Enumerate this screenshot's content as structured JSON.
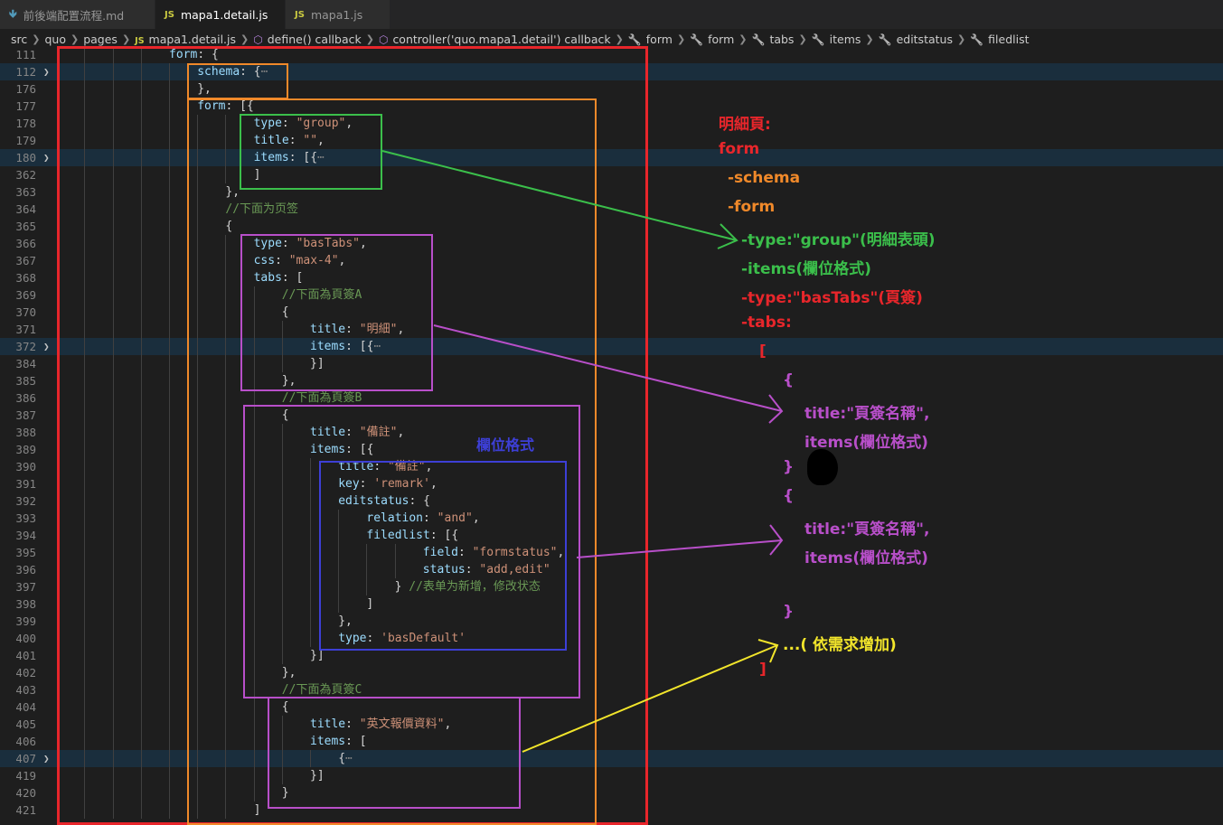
{
  "tabs": [
    {
      "icon": "markdown-icon",
      "label": "前後端配置流程.md",
      "active": false,
      "dirty": false
    },
    {
      "icon": "JS",
      "label": "mapa1.detail.js",
      "active": true,
      "dirty": true
    },
    {
      "icon": "JS",
      "label": "mapa1.js",
      "active": false,
      "dirty": false
    }
  ],
  "breadcrumb": [
    {
      "icon": "",
      "label": "src"
    },
    {
      "icon": "",
      "label": "quo"
    },
    {
      "icon": "",
      "label": "pages"
    },
    {
      "icon": "js",
      "label": "mapa1.detail.js"
    },
    {
      "icon": "cube",
      "label": "define() callback"
    },
    {
      "icon": "cube",
      "label": "controller('quo.mapa1.detail') callback"
    },
    {
      "icon": "wrench",
      "label": "form"
    },
    {
      "icon": "wrench",
      "label": "form"
    },
    {
      "icon": "wrench",
      "label": "tabs"
    },
    {
      "icon": "wrench",
      "label": "items"
    },
    {
      "icon": "wrench",
      "label": "editstatus"
    },
    {
      "icon": "wrench",
      "label": "filedlist"
    }
  ],
  "code_lines": [
    {
      "n": "111",
      "indent": 15,
      "fold": false,
      "hl": false,
      "tokens": [
        [
          "k",
          "form"
        ],
        [
          "p",
          ": {"
        ]
      ]
    },
    {
      "n": "112",
      "indent": 19,
      "fold": true,
      "hl": true,
      "tokens": [
        [
          "k",
          "schema"
        ],
        [
          "p",
          ": {"
        ],
        [
          "e",
          "⋯"
        ]
      ]
    },
    {
      "n": "176",
      "indent": 19,
      "fold": false,
      "hl": false,
      "tokens": [
        [
          "p",
          "},"
        ]
      ]
    },
    {
      "n": "177",
      "indent": 19,
      "fold": false,
      "hl": false,
      "tokens": [
        [
          "k",
          "form"
        ],
        [
          "p",
          ": [{"
        ]
      ]
    },
    {
      "n": "178",
      "indent": 27,
      "fold": false,
      "hl": false,
      "tokens": [
        [
          "k",
          "type"
        ],
        [
          "p",
          ": "
        ],
        [
          "s",
          "\"group\""
        ],
        [
          "p",
          ","
        ]
      ]
    },
    {
      "n": "179",
      "indent": 27,
      "fold": false,
      "hl": false,
      "tokens": [
        [
          "k",
          "title"
        ],
        [
          "p",
          ": "
        ],
        [
          "s",
          "\"\""
        ],
        [
          "p",
          ","
        ]
      ]
    },
    {
      "n": "180",
      "indent": 27,
      "fold": true,
      "hl": true,
      "tokens": [
        [
          "k",
          "items"
        ],
        [
          "p",
          ": [{"
        ],
        [
          "e",
          "⋯"
        ]
      ]
    },
    {
      "n": "362",
      "indent": 27,
      "fold": false,
      "hl": false,
      "tokens": [
        [
          "p",
          "]"
        ]
      ]
    },
    {
      "n": "363",
      "indent": 23,
      "fold": false,
      "hl": false,
      "tokens": [
        [
          "p",
          "},"
        ]
      ]
    },
    {
      "n": "364",
      "indent": 23,
      "fold": false,
      "hl": false,
      "tokens": [
        [
          "c",
          "//下面为页签"
        ]
      ]
    },
    {
      "n": "365",
      "indent": 23,
      "fold": false,
      "hl": false,
      "tokens": [
        [
          "p",
          "{"
        ]
      ]
    },
    {
      "n": "366",
      "indent": 27,
      "fold": false,
      "hl": false,
      "tokens": [
        [
          "k",
          "type"
        ],
        [
          "p",
          ": "
        ],
        [
          "s",
          "\"basTabs\""
        ],
        [
          "p",
          ","
        ]
      ]
    },
    {
      "n": "367",
      "indent": 27,
      "fold": false,
      "hl": false,
      "tokens": [
        [
          "k",
          "css"
        ],
        [
          "p",
          ": "
        ],
        [
          "s",
          "\"max-4\""
        ],
        [
          "p",
          ","
        ]
      ]
    },
    {
      "n": "368",
      "indent": 27,
      "fold": false,
      "hl": false,
      "tokens": [
        [
          "k",
          "tabs"
        ],
        [
          "p",
          ": ["
        ]
      ]
    },
    {
      "n": "369",
      "indent": 31,
      "fold": false,
      "hl": false,
      "tokens": [
        [
          "c",
          "//下面為頁簽A"
        ]
      ]
    },
    {
      "n": "370",
      "indent": 31,
      "fold": false,
      "hl": false,
      "tokens": [
        [
          "p",
          "{"
        ]
      ]
    },
    {
      "n": "371",
      "indent": 35,
      "fold": false,
      "hl": false,
      "tokens": [
        [
          "k",
          "title"
        ],
        [
          "p",
          ": "
        ],
        [
          "s",
          "\"明細\""
        ],
        [
          "p",
          ","
        ]
      ]
    },
    {
      "n": "372",
      "indent": 35,
      "fold": true,
      "hl": true,
      "tokens": [
        [
          "k",
          "items"
        ],
        [
          "p",
          ": [{"
        ],
        [
          "e",
          "⋯"
        ]
      ]
    },
    {
      "n": "384",
      "indent": 35,
      "fold": false,
      "hl": false,
      "tokens": [
        [
          "p",
          "}]"
        ]
      ]
    },
    {
      "n": "385",
      "indent": 31,
      "fold": false,
      "hl": false,
      "tokens": [
        [
          "p",
          "},"
        ]
      ]
    },
    {
      "n": "386",
      "indent": 31,
      "fold": false,
      "hl": false,
      "tokens": [
        [
          "c",
          "//下面為頁簽B"
        ]
      ]
    },
    {
      "n": "387",
      "indent": 31,
      "fold": false,
      "hl": false,
      "tokens": [
        [
          "p",
          "{"
        ]
      ]
    },
    {
      "n": "388",
      "indent": 35,
      "fold": false,
      "hl": false,
      "tokens": [
        [
          "k",
          "title"
        ],
        [
          "p",
          ": "
        ],
        [
          "s",
          "\"備註\""
        ],
        [
          "p",
          ","
        ]
      ]
    },
    {
      "n": "389",
      "indent": 35,
      "fold": false,
      "hl": false,
      "tokens": [
        [
          "k",
          "items"
        ],
        [
          "p",
          ": [{"
        ]
      ]
    },
    {
      "n": "390",
      "indent": 39,
      "fold": false,
      "hl": false,
      "tokens": [
        [
          "k",
          "title"
        ],
        [
          "p",
          ": "
        ],
        [
          "s",
          "\"備註\""
        ],
        [
          "p",
          ","
        ]
      ]
    },
    {
      "n": "391",
      "indent": 39,
      "fold": false,
      "hl": false,
      "tokens": [
        [
          "k",
          "key"
        ],
        [
          "p",
          ": "
        ],
        [
          "s",
          "'remark'"
        ],
        [
          "p",
          ","
        ]
      ]
    },
    {
      "n": "392",
      "indent": 39,
      "fold": false,
      "hl": false,
      "tokens": [
        [
          "k",
          "editstatus"
        ],
        [
          "p",
          ": {"
        ]
      ]
    },
    {
      "n": "393",
      "indent": 43,
      "fold": false,
      "hl": false,
      "tokens": [
        [
          "k",
          "relation"
        ],
        [
          "p",
          ": "
        ],
        [
          "s",
          "\"and\""
        ],
        [
          "p",
          ","
        ]
      ]
    },
    {
      "n": "394",
      "indent": 43,
      "fold": false,
      "hl": false,
      "tokens": [
        [
          "k",
          "filedlist"
        ],
        [
          "p",
          ": [{"
        ]
      ]
    },
    {
      "n": "395",
      "indent": 51,
      "fold": false,
      "hl": false,
      "tokens": [
        [
          "k",
          "field"
        ],
        [
          "p",
          ": "
        ],
        [
          "s",
          "\"formstatus\""
        ],
        [
          "p",
          ","
        ]
      ]
    },
    {
      "n": "396",
      "indent": 51,
      "fold": false,
      "hl": false,
      "tokens": [
        [
          "k",
          "status"
        ],
        [
          "p",
          ": "
        ],
        [
          "s",
          "\"add,edit\""
        ]
      ]
    },
    {
      "n": "397",
      "indent": 47,
      "fold": false,
      "hl": false,
      "tokens": [
        [
          "p",
          "} "
        ],
        [
          "c",
          "//表单为新增，修改状态"
        ]
      ]
    },
    {
      "n": "398",
      "indent": 43,
      "fold": false,
      "hl": false,
      "tokens": [
        [
          "p",
          "]"
        ]
      ]
    },
    {
      "n": "399",
      "indent": 39,
      "fold": false,
      "hl": false,
      "tokens": [
        [
          "p",
          "},"
        ]
      ]
    },
    {
      "n": "400",
      "indent": 39,
      "fold": false,
      "hl": false,
      "tokens": [
        [
          "k",
          "type"
        ],
        [
          "p",
          ": "
        ],
        [
          "s",
          "'basDefault'"
        ]
      ]
    },
    {
      "n": "401",
      "indent": 35,
      "fold": false,
      "hl": false,
      "tokens": [
        [
          "p",
          "}]"
        ]
      ]
    },
    {
      "n": "402",
      "indent": 31,
      "fold": false,
      "hl": false,
      "tokens": [
        [
          "p",
          "},"
        ]
      ]
    },
    {
      "n": "403",
      "indent": 31,
      "fold": false,
      "hl": false,
      "tokens": [
        [
          "c",
          "//下面為頁簽C"
        ]
      ]
    },
    {
      "n": "404",
      "indent": 31,
      "fold": false,
      "hl": false,
      "tokens": [
        [
          "p",
          "{"
        ]
      ]
    },
    {
      "n": "405",
      "indent": 35,
      "fold": false,
      "hl": false,
      "tokens": [
        [
          "k",
          "title"
        ],
        [
          "p",
          ": "
        ],
        [
          "s",
          "\"英文報價資料\""
        ],
        [
          "p",
          ","
        ]
      ]
    },
    {
      "n": "406",
      "indent": 35,
      "fold": false,
      "hl": false,
      "tokens": [
        [
          "k",
          "items"
        ],
        [
          "p",
          ": ["
        ]
      ]
    },
    {
      "n": "407",
      "indent": 39,
      "fold": true,
      "hl": true,
      "tokens": [
        [
          "p",
          "{"
        ],
        [
          "e",
          "⋯"
        ]
      ]
    },
    {
      "n": "419",
      "indent": 35,
      "fold": false,
      "hl": false,
      "tokens": [
        [
          "p",
          "}]"
        ]
      ]
    },
    {
      "n": "420",
      "indent": 31,
      "fold": false,
      "hl": false,
      "tokens": [
        [
          "p",
          "}"
        ]
      ]
    },
    {
      "n": "421",
      "indent": 27,
      "fold": false,
      "hl": false,
      "tokens": [
        [
          "p",
          "]"
        ]
      ]
    }
  ],
  "annotations": {
    "fields_label": "欄位格式",
    "outline": [
      {
        "text": "明細頁:",
        "color": "#e8262b"
      },
      {
        "text": "form",
        "color": "#e8262b"
      },
      {
        "text": "-schema",
        "color": "#f0892a"
      },
      {
        "text": "-form",
        "color": "#f0892a"
      },
      {
        "text": "-type:\"group\"(明細表頭)",
        "color": "#3bbf4b"
      },
      {
        "text": "-items(欄位格式)",
        "color": "#3bbf4b"
      },
      {
        "text": "-type:\"basTabs\"(頁簽)",
        "color": "#e8262b"
      },
      {
        "text": "-tabs:",
        "color": "#e8262b"
      },
      {
        "text": "[",
        "color": "#e8262b"
      },
      {
        "text": "{",
        "color": "#b84fc9"
      },
      {
        "text": "title:\"頁簽名稱\",",
        "color": "#b84fc9"
      },
      {
        "text": "items(欄位格式)",
        "color": "#b84fc9"
      },
      {
        "text": "}",
        "color": "#b84fc9"
      },
      {
        "text": "{",
        "color": "#b84fc9"
      },
      {
        "text": "title:\"頁簽名稱\",",
        "color": "#b84fc9"
      },
      {
        "text": "items(欄位格式)",
        "color": "#b84fc9"
      },
      {
        "text": "}",
        "color": "#b84fc9"
      },
      {
        "text": "...( 依需求增加)",
        "color": "#f2e52b"
      },
      {
        "text": "]",
        "color": "#e8262b"
      }
    ]
  },
  "colors": {
    "red": "#e8262b",
    "orange": "#f0892a",
    "green": "#3bbf4b",
    "purple": "#b84fc9",
    "blue": "#3d3fd6",
    "yellow": "#f2e52b"
  }
}
